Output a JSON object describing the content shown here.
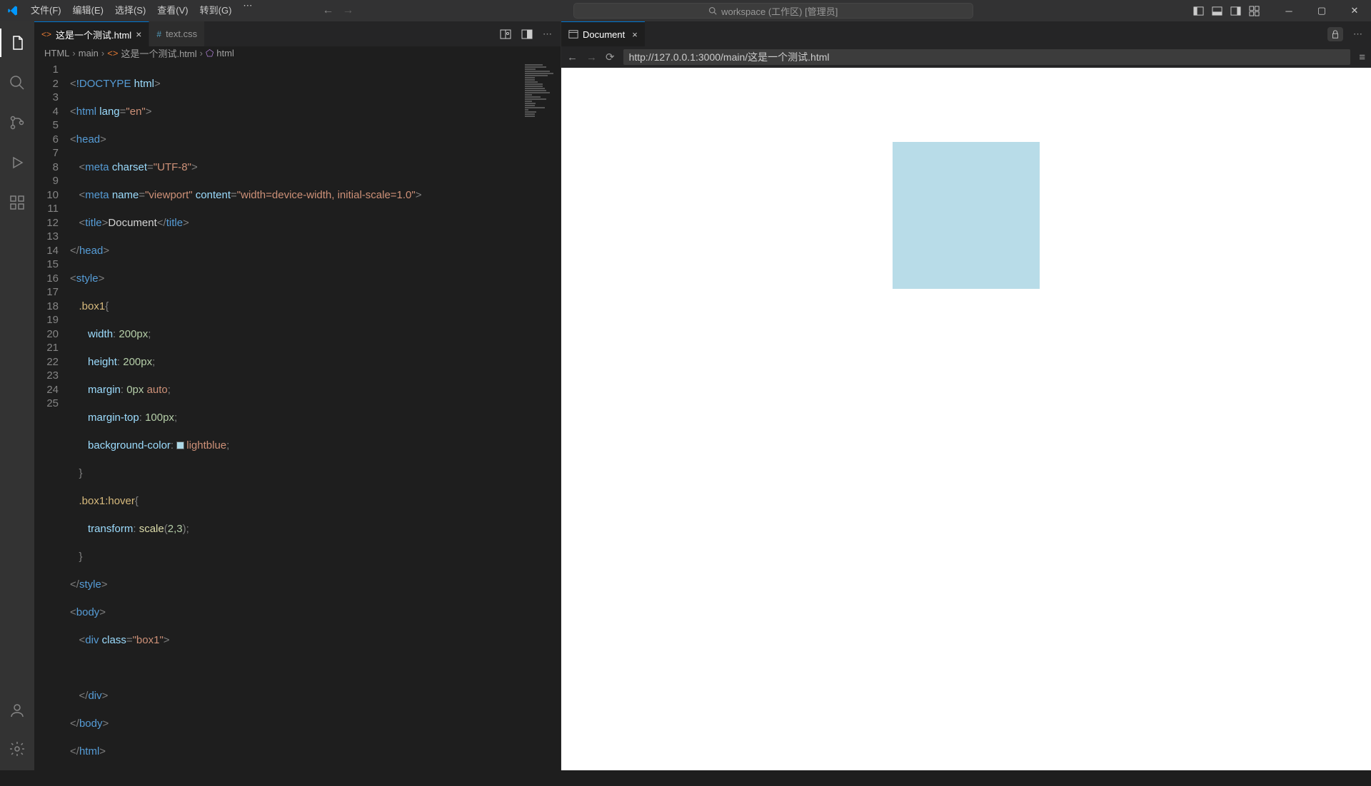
{
  "titlebar": {
    "menu": [
      "文件(F)",
      "编辑(E)",
      "选择(S)",
      "查看(V)",
      "转到(G)"
    ],
    "search_text": "workspace (工作区) [管理员]"
  },
  "tabs": [
    {
      "label": "这是一个测试.html",
      "active": true,
      "icon": "<>"
    },
    {
      "label": "text.css",
      "active": false,
      "icon": "#"
    }
  ],
  "breadcrumb": [
    "HTML",
    "main",
    "这是一个测试.html",
    "html"
  ],
  "gutter_lines": [
    "1",
    "2",
    "3",
    "4",
    "5",
    "6",
    "7",
    "8",
    "9",
    "10",
    "11",
    "12",
    "13",
    "14",
    "15",
    "16",
    "17",
    "18",
    "19",
    "20",
    "21",
    "22",
    "23",
    "24",
    "25"
  ],
  "preview_tab": {
    "label": "Document"
  },
  "url": "http://127.0.0.1:3000/main/这是一个测试.html",
  "code": {
    "l1": {
      "doctype": "!DOCTYPE",
      "html": "html"
    },
    "l2": {
      "tag": "html",
      "attr": "lang",
      "val": "\"en\""
    },
    "l3": {
      "tag": "head"
    },
    "l4": {
      "tag": "meta",
      "attr": "charset",
      "val": "\"UTF-8\""
    },
    "l5": {
      "tag": "meta",
      "a1": "name",
      "v1": "\"viewport\"",
      "a2": "content",
      "v2": "\"width=device-width, initial-scale=1.0\""
    },
    "l6": {
      "open": "title",
      "text": "Document",
      "close": "title"
    },
    "l7": {
      "tag": "head"
    },
    "l8": {
      "tag": "style"
    },
    "l9": {
      "sel": ".box1"
    },
    "l10": {
      "prop": "width",
      "val": "200px"
    },
    "l11": {
      "prop": "height",
      "val": "200px"
    },
    "l12": {
      "prop": "margin",
      "v1": "0px",
      "v2": "auto"
    },
    "l13": {
      "prop": "margin-top",
      "val": "100px"
    },
    "l14": {
      "prop": "background-color",
      "val": "lightblue"
    },
    "l16": {
      "sel": ".box1:hover"
    },
    "l17": {
      "prop": "transform",
      "func": "scale",
      "args": "2,3"
    },
    "l19": {
      "tag": "style"
    },
    "l20": {
      "tag": "body"
    },
    "l21": {
      "tag": "div",
      "attr": "class",
      "val": "\"box1\""
    },
    "l23": {
      "tag": "div"
    },
    "l24": {
      "tag": "body"
    },
    "l25": {
      "tag": "html"
    }
  }
}
